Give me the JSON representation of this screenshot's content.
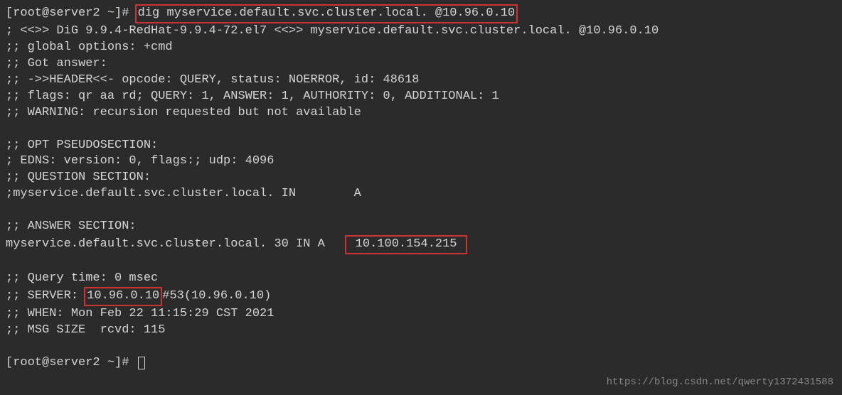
{
  "prompt1_prefix": "[root@server2 ~]# ",
  "prompt1_command": "dig myservice.default.svc.cluster.local. @10.96.0.10",
  "blank": "",
  "dig_version": "; <<>> DiG 9.9.4-RedHat-9.9.4-72.el7 <<>> myservice.default.svc.cluster.local. @10.96.0.10",
  "global_opts": ";; global options: +cmd",
  "got_answer": ";; Got answer:",
  "header": ";; ->>HEADER<<- opcode: QUERY, status: NOERROR, id: 48618",
  "flags": ";; flags: qr aa rd; QUERY: 1, ANSWER: 1, AUTHORITY: 0, ADDITIONAL: 1",
  "warning": ";; WARNING: recursion requested but not available",
  "opt_section": ";; OPT PSEUDOSECTION:",
  "edns": "; EDNS: version: 0, flags:; udp: 4096",
  "question_hdr": ";; QUESTION SECTION:",
  "question_rec": ";myservice.default.svc.cluster.local. IN        A",
  "answer_hdr": ";; ANSWER SECTION:",
  "answer_pre": "myservice.default.svc.cluster.local. 30 IN A   ",
  "answer_ip": " 10.100.154.215 ",
  "query_time": ";; Query time: 0 msec",
  "server_pre": ";; SERVER: ",
  "server_ip": "10.96.0.10",
  "server_post": "#53(10.96.0.10)",
  "when": ";; WHEN: Mon Feb 22 11:15:29 CST 2021",
  "msg_size": ";; MSG SIZE  rcvd: 115",
  "prompt2": "[root@server2 ~]# ",
  "watermark": "https://blog.csdn.net/qwerty1372431588"
}
